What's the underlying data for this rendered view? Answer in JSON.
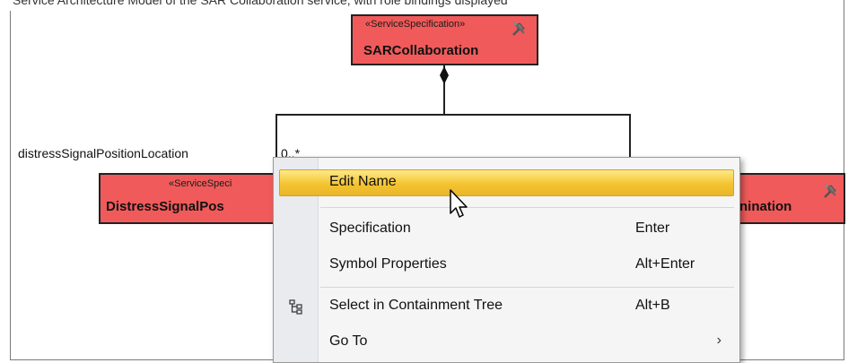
{
  "top_strip_text": "Service Architecture Model of the SAR Collaboration service, with role bindings displayed",
  "blocks": {
    "top": {
      "stereotype": "«ServiceSpecification»",
      "name": "SARCollaboration"
    },
    "left": {
      "stereotype": "«ServiceSpeci",
      "name": "DistressSignalPos"
    },
    "right": {
      "name": "nination"
    }
  },
  "role_label": "distressSignalPositionLocation",
  "multiplicity": "0..*",
  "context_menu": {
    "items": [
      {
        "label": "Edit Name",
        "shortcut": ""
      },
      {
        "label": "Specification",
        "shortcut": "Enter"
      },
      {
        "label": "Symbol Properties",
        "shortcut": "Alt+Enter"
      },
      {
        "label": "Select in Containment Tree",
        "shortcut": "Alt+B",
        "icon": "containment-tree-icon"
      },
      {
        "label": "Go To",
        "shortcut": "",
        "submenu_arrow": "›"
      }
    ]
  },
  "colors": {
    "block_fill": "#f05a5a",
    "highlight": "#f4c430"
  }
}
